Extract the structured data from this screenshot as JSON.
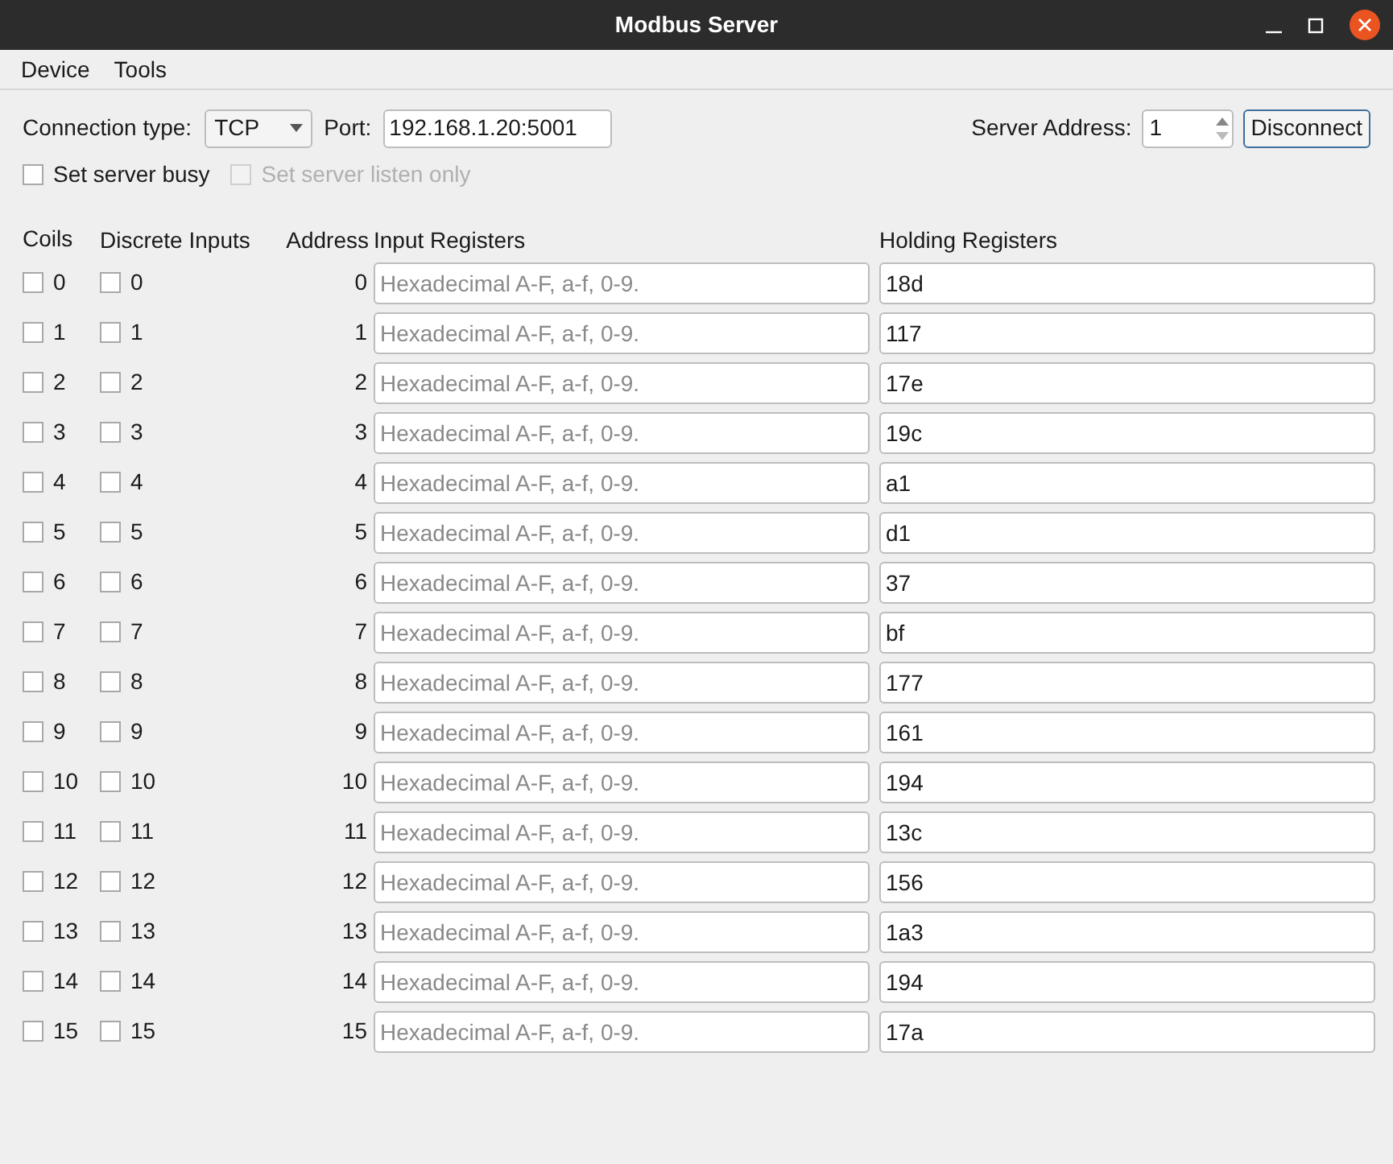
{
  "window": {
    "title": "Modbus Server"
  },
  "menu": [
    "Device",
    "Tools"
  ],
  "connection": {
    "type_label": "Connection type:",
    "type_value": "TCP",
    "port_label": "Port:",
    "port_value": "192.168.1.20:5001",
    "server_address_label": "Server Address:",
    "server_address_value": "1",
    "button": "Disconnect"
  },
  "options": [
    {
      "label": "Set server busy",
      "checked": false,
      "disabled": false
    },
    {
      "label": "Set server listen only",
      "checked": false,
      "disabled": true
    }
  ],
  "table": {
    "columns": [
      "Coils",
      "Discrete Inputs",
      "Address",
      "Input Registers",
      "Holding Registers"
    ],
    "rows": [
      {
        "coil": {
          "label": "0",
          "checked": false
        },
        "discrete": {
          "label": "0",
          "checked": false
        },
        "address": "0",
        "input_placeholder": "Hexadecimal A-F, a-f, 0-9.",
        "holding": "18d"
      },
      {
        "coil": {
          "label": "1",
          "checked": false
        },
        "discrete": {
          "label": "1",
          "checked": false
        },
        "address": "1",
        "input_placeholder": "Hexadecimal A-F, a-f, 0-9.",
        "holding": "117"
      },
      {
        "coil": {
          "label": "2",
          "checked": false
        },
        "discrete": {
          "label": "2",
          "checked": false
        },
        "address": "2",
        "input_placeholder": "Hexadecimal A-F, a-f, 0-9.",
        "holding": "17e"
      },
      {
        "coil": {
          "label": "3",
          "checked": false
        },
        "discrete": {
          "label": "3",
          "checked": false
        },
        "address": "3",
        "input_placeholder": "Hexadecimal A-F, a-f, 0-9.",
        "holding": "19c"
      },
      {
        "coil": {
          "label": "4",
          "checked": false
        },
        "discrete": {
          "label": "4",
          "checked": false
        },
        "address": "4",
        "input_placeholder": "Hexadecimal A-F, a-f, 0-9.",
        "holding": "a1"
      },
      {
        "coil": {
          "label": "5",
          "checked": false
        },
        "discrete": {
          "label": "5",
          "checked": false
        },
        "address": "5",
        "input_placeholder": "Hexadecimal A-F, a-f, 0-9.",
        "holding": "d1"
      },
      {
        "coil": {
          "label": "6",
          "checked": false
        },
        "discrete": {
          "label": "6",
          "checked": false
        },
        "address": "6",
        "input_placeholder": "Hexadecimal A-F, a-f, 0-9.",
        "holding": "37"
      },
      {
        "coil": {
          "label": "7",
          "checked": false
        },
        "discrete": {
          "label": "7",
          "checked": false
        },
        "address": "7",
        "input_placeholder": "Hexadecimal A-F, a-f, 0-9.",
        "holding": "bf"
      },
      {
        "coil": {
          "label": "8",
          "checked": false
        },
        "discrete": {
          "label": "8",
          "checked": false
        },
        "address": "8",
        "input_placeholder": "Hexadecimal A-F, a-f, 0-9.",
        "holding": "177"
      },
      {
        "coil": {
          "label": "9",
          "checked": false
        },
        "discrete": {
          "label": "9",
          "checked": false
        },
        "address": "9",
        "input_placeholder": "Hexadecimal A-F, a-f, 0-9.",
        "holding": "161"
      },
      {
        "coil": {
          "label": "10",
          "checked": false
        },
        "discrete": {
          "label": "10",
          "checked": false
        },
        "address": "10",
        "input_placeholder": "Hexadecimal A-F, a-f, 0-9.",
        "holding": "194"
      },
      {
        "coil": {
          "label": "11",
          "checked": false
        },
        "discrete": {
          "label": "11",
          "checked": false
        },
        "address": "11",
        "input_placeholder": "Hexadecimal A-F, a-f, 0-9.",
        "holding": "13c"
      },
      {
        "coil": {
          "label": "12",
          "checked": false
        },
        "discrete": {
          "label": "12",
          "checked": false
        },
        "address": "12",
        "input_placeholder": "Hexadecimal A-F, a-f, 0-9.",
        "holding": "156"
      },
      {
        "coil": {
          "label": "13",
          "checked": false
        },
        "discrete": {
          "label": "13",
          "checked": false
        },
        "address": "13",
        "input_placeholder": "Hexadecimal A-F, a-f, 0-9.",
        "holding": "1a3"
      },
      {
        "coil": {
          "label": "14",
          "checked": false
        },
        "discrete": {
          "label": "14",
          "checked": false
        },
        "address": "14",
        "input_placeholder": "Hexadecimal A-F, a-f, 0-9.",
        "holding": "194"
      },
      {
        "coil": {
          "label": "15",
          "checked": false
        },
        "discrete": {
          "label": "15",
          "checked": false
        },
        "address": "15",
        "input_placeholder": "Hexadecimal A-F, a-f, 0-9.",
        "holding": "17a"
      }
    ]
  }
}
